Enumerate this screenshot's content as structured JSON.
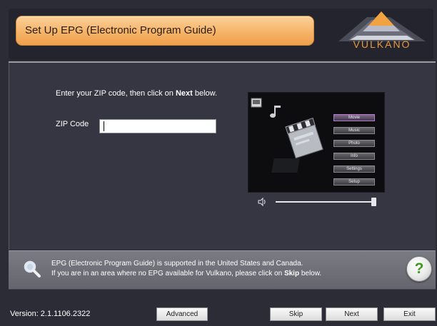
{
  "header": {
    "title": "Set Up EPG (Electronic Program Guide)",
    "logo_text": "VULKANO"
  },
  "main": {
    "instruction_prefix": "Enter your ZIP code, then click on ",
    "instruction_strong": "Next",
    "instruction_suffix": " below.",
    "zip_label": "ZIP Code",
    "zip_value": "",
    "preview": {
      "menu_items": [
        "Movie",
        "Music",
        "Photo",
        "Info",
        "Settings",
        "Setup"
      ],
      "volume_level": 0.97
    }
  },
  "info": {
    "line1": "EPG (Electronic Program Guide) is supported in the United States and Canada.",
    "line2_prefix": "If you are in an area where no EPG available for Vulkano, please click on ",
    "line2_strong": "Skip",
    "line2_suffix": " below.",
    "help_label": "?"
  },
  "footer": {
    "version": "Version: 2.1.1106.2322",
    "advanced_label": "Advanced",
    "skip_label": "Skip",
    "next_label": "Next",
    "exit_label": "Exit"
  },
  "colors": {
    "accent_orange": "#f5b468",
    "background": "#2b2c36",
    "help_green": "#3a9b1c"
  },
  "icons": [
    "vulkano-logo-icon",
    "magnifier-icon",
    "help-icon",
    "volume-icon",
    "film-clapper-icon",
    "music-note-icon"
  ]
}
